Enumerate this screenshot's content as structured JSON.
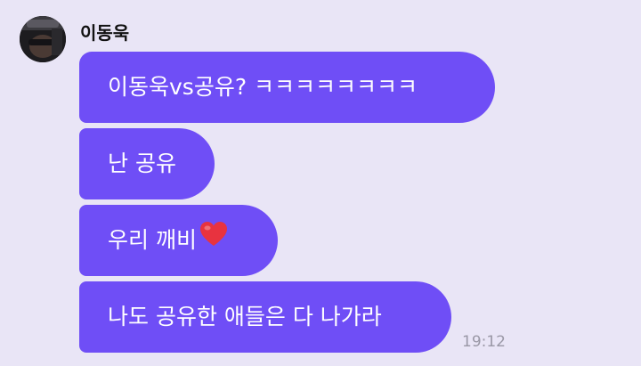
{
  "chat": {
    "sender_name": "이동욱",
    "messages": [
      {
        "text": "이동욱vs공유? ㅋㅋㅋㅋㅋㅋㅋㅋ"
      },
      {
        "text": "난 공유"
      },
      {
        "text": "우리 깨비",
        "emoji": "red-heart-icon"
      },
      {
        "text": "나도 공유한 애들은 다 나가라"
      }
    ],
    "timestamp": "19:12"
  },
  "colors": {
    "background": "#e9e5f6",
    "bubble": "#6f4ef6",
    "bubble_text": "#ffffff",
    "timestamp": "#9a98a6",
    "heart": "#e8333f"
  }
}
